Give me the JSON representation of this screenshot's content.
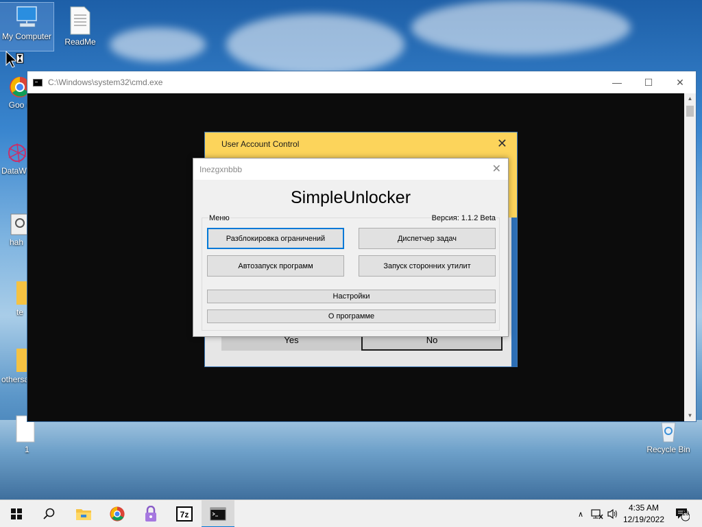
{
  "desktop": {
    "icons": [
      {
        "label": "My Computer"
      },
      {
        "label": "ReadMe"
      },
      {
        "label": "Goo Chr"
      },
      {
        "label": "DataW"
      },
      {
        "label": "hah"
      },
      {
        "label": "te"
      },
      {
        "label": "othersa"
      },
      {
        "label": "1"
      },
      {
        "label": "Recycle Bin"
      }
    ]
  },
  "cmd": {
    "title": "C:\\Windows\\system32\\cmd.exe",
    "minimize": "—",
    "maximize": "☐",
    "close": "✕"
  },
  "uac": {
    "title": "User Account Control",
    "close": "✕",
    "yes": "Yes",
    "no": "No"
  },
  "unlocker": {
    "window_title": "Inezgxnbbb",
    "close": "✕",
    "app_name": "SimpleUnlocker",
    "group_label": "Меню",
    "version": "Версия: 1.1.2 Beta",
    "buttons": {
      "unlock": "Разблокировка ограничений",
      "task_manager": "Диспетчер задач",
      "autostart": "Автозапуск программ",
      "third_party": "Запуск сторонних утилит",
      "settings": "Настройки",
      "about": "О программе"
    }
  },
  "taskbar": {
    "time": "4:35 AM",
    "date": "12/19/2022",
    "notification_count": "10",
    "apps": [
      "start-icon",
      "search-icon",
      "file-explorer-icon",
      "chrome-icon",
      "lock-app-icon",
      "7zip-icon",
      "cmd-icon"
    ]
  },
  "colors": {
    "uac_yellow": "#fcd45b",
    "accent_blue": "#0078d7",
    "cmd_background": "#0c0c0c"
  }
}
